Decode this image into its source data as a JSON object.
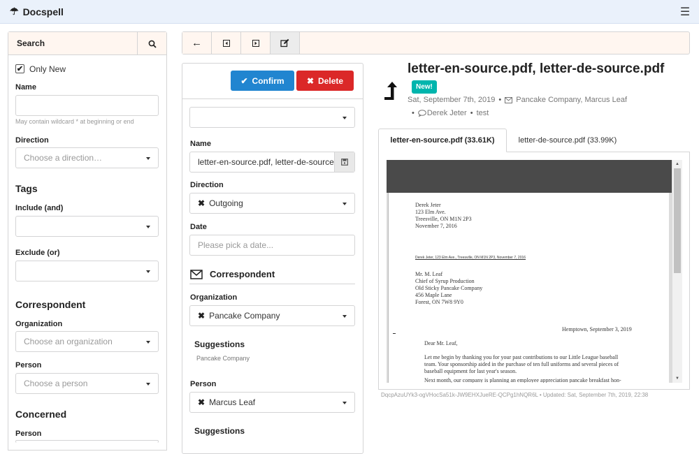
{
  "app": {
    "name": "Docspell"
  },
  "search": {
    "title": "Search",
    "only_new_label": "Only New",
    "name_label": "Name",
    "name_hint": "May contain wildcard * at beginning or end",
    "direction_label": "Direction",
    "direction_placeholder": "Choose a direction…",
    "tags_header": "Tags",
    "include_label": "Include (and)",
    "exclude_label": "Exclude (or)",
    "correspondent_header": "Correspondent",
    "organization_label": "Organization",
    "organization_placeholder": "Choose an organization",
    "person_label": "Person",
    "person_placeholder": "Choose a person",
    "concerned_header": "Concerned",
    "concerned_person_label": "Person"
  },
  "edit": {
    "confirm_label": "Confirm",
    "delete_label": "Delete",
    "name_label": "Name",
    "name_value": "letter-en-source.pdf, letter-de-source.",
    "direction_label": "Direction",
    "direction_value": "Outgoing",
    "date_label": "Date",
    "date_placeholder": "Please pick a date...",
    "correspondent_header": "Correspondent",
    "organization_label": "Organization",
    "organization_value": "Pancake Company",
    "suggestions_label": "Suggestions",
    "org_suggestion": "Pancake Company",
    "person_label": "Person",
    "person_value": "Marcus Leaf",
    "suggestions2_label": "Suggestions"
  },
  "item": {
    "title": "letter-en-source.pdf, letter-de-source.pdf",
    "badge": "New!",
    "date": "Sat, September 7th, 2019",
    "correspondent": "Pancake Company, Marcus Leaf",
    "concerned": "Derek Jeter",
    "tag": "test",
    "tabs": [
      "letter-en-source.pdf (33.61K)",
      "letter-de-source.pdf (33.99K)"
    ],
    "footer": "DqcpAzuUYk3-ogVHocSa51k-JW9EHXJueRE-QCPg1hNQR6L • Updated: Sat, September 7th, 2019, 22:38"
  },
  "pdf": {
    "sender": [
      "Derek Jeter",
      "123 Elm Ave.",
      "Treesville, ON M1N 2P3",
      "November 7, 2016"
    ],
    "return_line": "Derek Jeter, 123 Elm Ave., Treesville, ON M1N 2P3, November 7, 2016",
    "recipient": [
      "Mr. M. Leaf",
      "Chief of Syrup Production",
      "Old Sticky Pancake Company",
      "456 Maple Lane",
      "Forest, ON 7W8 9Y0"
    ],
    "place_date": "Hemptown, September 3, 2019",
    "salutation": "Dear Mr. Leaf,",
    "body": [
      "Let me begin by thanking you for your past contributions to our Little League baseball",
      "team. Your sponsorship aided in the purchase of ten full uniforms and several pieces of",
      "baseball equipment for last year's season.",
      "Next month, our company is planning an employee appreciation pancake breakfast hon-"
    ]
  },
  "colors": {
    "topbar": "#eaf1fb",
    "confirm": "#2185d0",
    "delete": "#db2828",
    "badge": "#00b5ad",
    "menu_bg": "#fff6f0"
  }
}
